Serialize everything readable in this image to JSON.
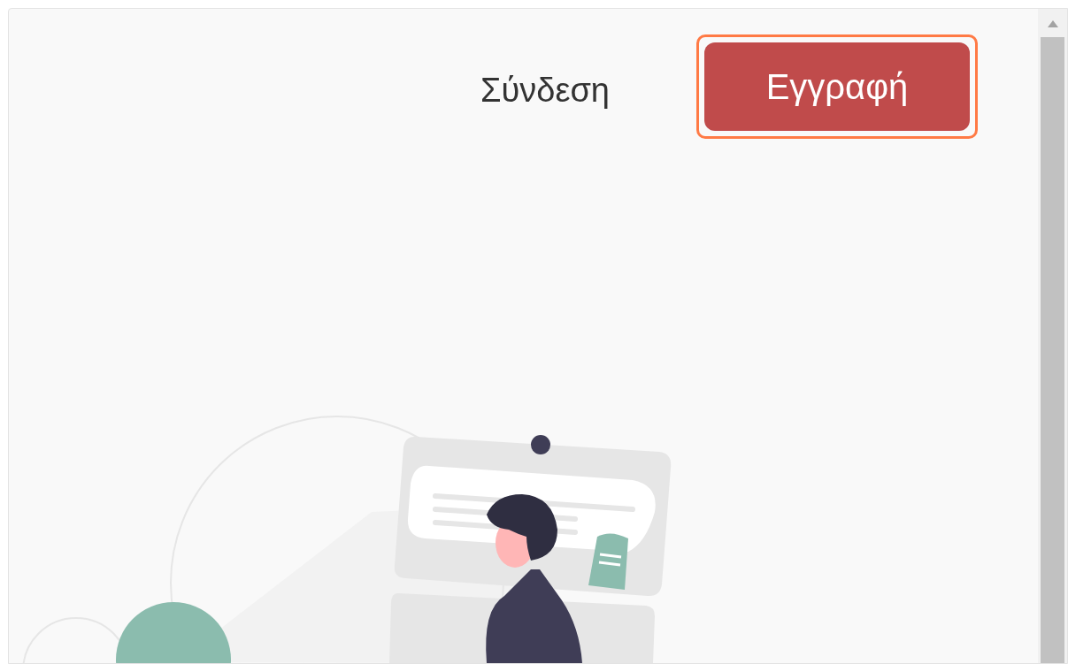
{
  "nav": {
    "login_link": "Σύνδεση",
    "signup_button": "Εγγραφή"
  }
}
